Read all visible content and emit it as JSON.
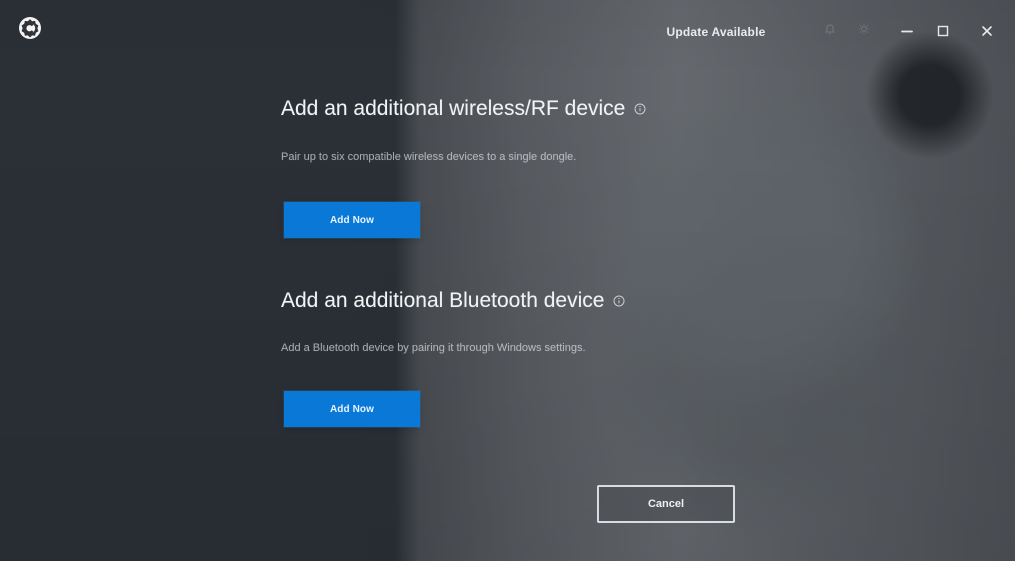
{
  "title_bar": {
    "update_label": "Update Available",
    "logo_icon": "app-logo-icon",
    "faint_icons": [
      "faint-bell-icon",
      "faint-gear-icon"
    ],
    "controls": [
      "minimize-icon",
      "restore-icon",
      "close-icon"
    ]
  },
  "sections": [
    {
      "title": "Add an additional wireless/RF device",
      "info_icon": "info-icon",
      "description": "Pair up to six compatible wireless devices to a single dongle.",
      "button_label": "Add Now"
    },
    {
      "title": "Add an additional Bluetooth device",
      "info_icon": "info-icon",
      "description": "Add a Bluetooth device by pairing it through Windows settings.",
      "button_label": "Add Now"
    }
  ],
  "footer": {
    "cancel_label": "Cancel"
  },
  "colors": {
    "primary_button": "#0a78d7",
    "text_primary": "#f1f3f5",
    "text_secondary": "#e6e9ec",
    "dark_panel": "#2b3037"
  }
}
